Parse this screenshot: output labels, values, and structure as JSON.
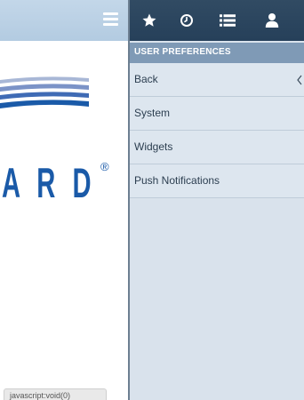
{
  "main": {
    "logo_text": "A R D",
    "logo_mark": "®",
    "status_text": "javascript:void(0)"
  },
  "toolbar": {
    "icons": [
      "star-icon",
      "clock-icon",
      "list-icon",
      "user-icon"
    ]
  },
  "panel": {
    "title": "USER PREFERENCES",
    "items": [
      {
        "label": "Back"
      },
      {
        "label": "System"
      },
      {
        "label": "Widgets"
      },
      {
        "label": "Push Notifications"
      }
    ]
  },
  "colors": {
    "topbar": "#b3cbe1",
    "iconbar": "#26405a",
    "panel_header": "#7f9ab6",
    "panel_bg": "#d9e2ec",
    "logo_blue": "#1a5aa8"
  }
}
